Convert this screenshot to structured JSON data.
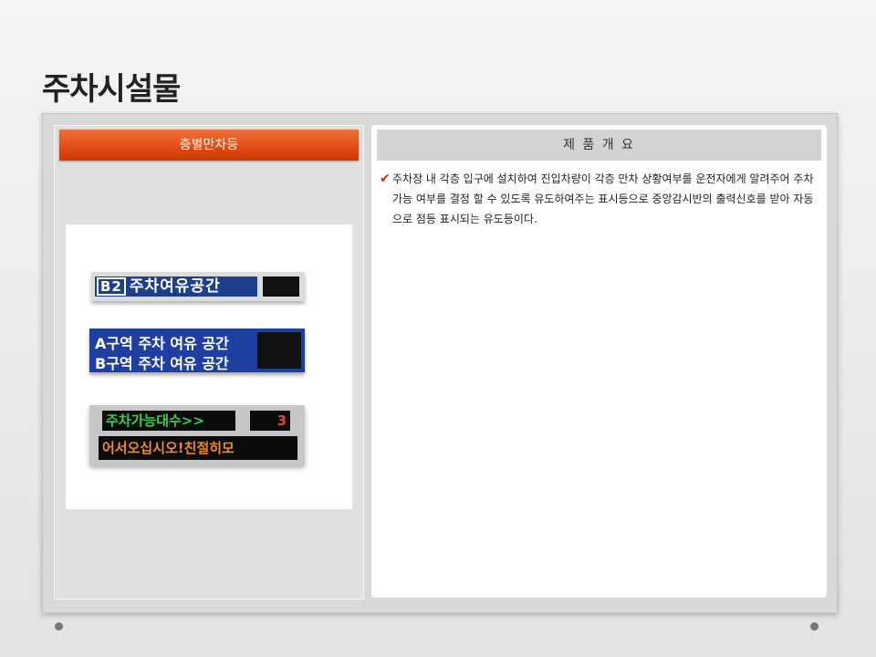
{
  "slide": {
    "title": "주차시설물"
  },
  "left": {
    "header": "층별만차등",
    "signs": {
      "sign1": {
        "badge": "B2",
        "text": "주차여유공간"
      },
      "sign2": {
        "line1": "A구역 주차 여유 공간",
        "line2": "B구역 주차 여유 공간"
      },
      "sign3": {
        "green": "주차가능대수>>",
        "count": "3",
        "orange": "어서오십시오!친절히모"
      }
    }
  },
  "right": {
    "header": "제 품 개 요",
    "check_glyph": "✔",
    "description": "주차장 내 각층 입구에 설치하여 진입차량이 각층 만차 상황여부를 운전자에게 알려주어 주차가능 여부를 결정 할 수 있도록 유도하여주는 표시등으로 중앙감시반의 출력신호를 받아 자동으로 점등 표시되는 유도등이다."
  },
  "colors": {
    "accent": "#e04a12",
    "check": "#d42a12"
  }
}
